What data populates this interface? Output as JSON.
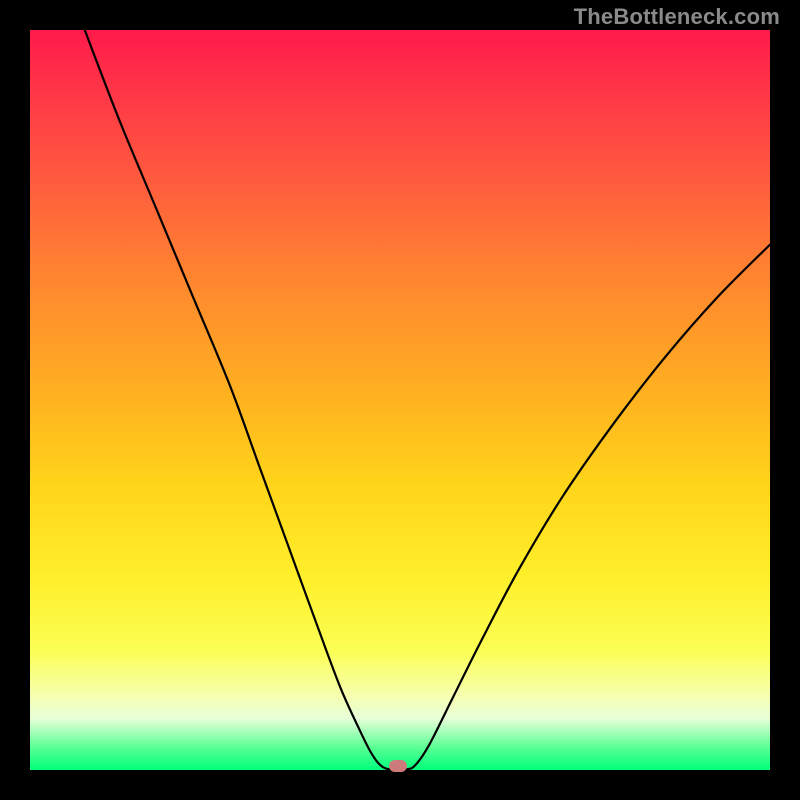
{
  "watermark": "TheBottleneck.com",
  "chart_data": {
    "type": "line",
    "title": "",
    "xlabel": "",
    "ylabel": "",
    "xlim": [
      0,
      1
    ],
    "ylim": [
      0,
      1
    ],
    "grid": false,
    "gradient_stops": [
      {
        "pos": 0.0,
        "color": "#ff1a4b"
      },
      {
        "pos": 0.08,
        "color": "#ff3547"
      },
      {
        "pos": 0.2,
        "color": "#ff5a3e"
      },
      {
        "pos": 0.35,
        "color": "#ff8a2e"
      },
      {
        "pos": 0.5,
        "color": "#ffb31f"
      },
      {
        "pos": 0.62,
        "color": "#ffd61a"
      },
      {
        "pos": 0.74,
        "color": "#ffef2a"
      },
      {
        "pos": 0.84,
        "color": "#fbff55"
      },
      {
        "pos": 0.9,
        "color": "#f5ffb0"
      },
      {
        "pos": 0.93,
        "color": "#e8ffd8"
      },
      {
        "pos": 0.97,
        "color": "#59ff93"
      },
      {
        "pos": 1.0,
        "color": "#00ff7d"
      }
    ],
    "series": [
      {
        "name": "bottleneck-curve",
        "points": [
          {
            "x": 0.074,
            "y": 1.0
          },
          {
            "x": 0.12,
            "y": 0.88
          },
          {
            "x": 0.17,
            "y": 0.76
          },
          {
            "x": 0.22,
            "y": 0.64
          },
          {
            "x": 0.27,
            "y": 0.52
          },
          {
            "x": 0.31,
            "y": 0.41
          },
          {
            "x": 0.35,
            "y": 0.3
          },
          {
            "x": 0.39,
            "y": 0.19
          },
          {
            "x": 0.42,
            "y": 0.11
          },
          {
            "x": 0.445,
            "y": 0.055
          },
          {
            "x": 0.46,
            "y": 0.025
          },
          {
            "x": 0.472,
            "y": 0.008
          },
          {
            "x": 0.485,
            "y": 0.001
          },
          {
            "x": 0.51,
            "y": 0.001
          },
          {
            "x": 0.522,
            "y": 0.008
          },
          {
            "x": 0.54,
            "y": 0.035
          },
          {
            "x": 0.57,
            "y": 0.095
          },
          {
            "x": 0.61,
            "y": 0.175
          },
          {
            "x": 0.66,
            "y": 0.27
          },
          {
            "x": 0.72,
            "y": 0.37
          },
          {
            "x": 0.79,
            "y": 0.47
          },
          {
            "x": 0.86,
            "y": 0.56
          },
          {
            "x": 0.93,
            "y": 0.64
          },
          {
            "x": 1.0,
            "y": 0.71
          }
        ]
      }
    ],
    "marker": {
      "x": 0.497,
      "y": 0.005,
      "color": "#cc7a7a"
    }
  }
}
